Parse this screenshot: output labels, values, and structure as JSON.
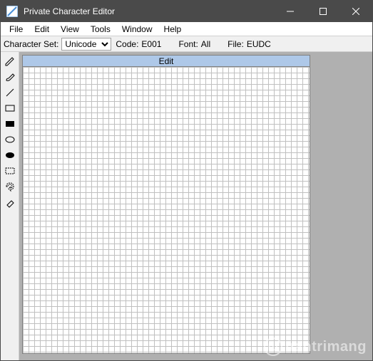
{
  "titlebar": {
    "title": "Private Character Editor"
  },
  "menubar": {
    "file": "File",
    "edit": "Edit",
    "view": "View",
    "tools": "Tools",
    "window": "Window",
    "help": "Help"
  },
  "infobar": {
    "charset_label": "Character Set:",
    "charset_value": "Unicode",
    "code_label": "Code:",
    "code_value": "E001",
    "font_label": "Font:",
    "font_value": "All",
    "file_label": "File:",
    "file_value": "EUDC"
  },
  "canvas": {
    "edit_header": "Edit"
  },
  "watermark": {
    "symbol": "Ш",
    "text": "uantrimang"
  }
}
